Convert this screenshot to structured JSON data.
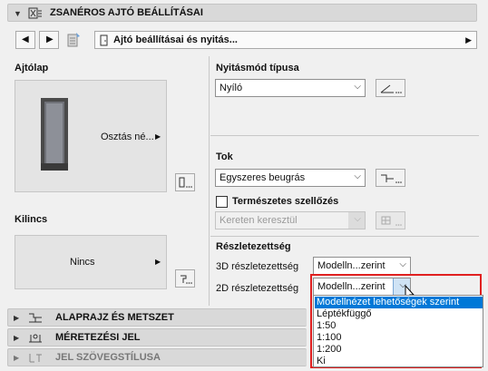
{
  "header": {
    "title": "ZSANÉROS AJTÓ BEÁLLÍTÁSAI"
  },
  "toolbar": {
    "path_label": "Ajtó beállításai és nyitás..."
  },
  "left": {
    "ajtolap_label": "Ajtólap",
    "ajtolap_button": "Osztás né...",
    "kilincs_label": "Kilincs",
    "kilincs_button": "Nincs"
  },
  "right": {
    "nyitasmod_label": "Nyitásmód típusa",
    "nyitasmod_value": "Nyíló",
    "tok_label": "Tok",
    "tok_value": "Egyszeres beugrás",
    "szellozes_label": "Természetes szellőzés",
    "szellozes_value": "Kereten keresztül",
    "reszletezettseg_label": "Részletezettség",
    "d3_label": "3D részletezettség",
    "d3_value": "Modelln...zerint",
    "d2_label": "2D részletezettség",
    "d2_value": "Modelln...zerint"
  },
  "dropdown": {
    "options": [
      "Modellnézet lehetőségek szerint",
      "Léptékfüggő",
      "1:50",
      "1:100",
      "1:200",
      "Ki"
    ],
    "selected_index": 0,
    "highlight_color": "#0078d7",
    "border_color": "#e02020"
  },
  "sections": [
    {
      "label": "ALAPRAJZ ÉS METSZET"
    },
    {
      "label": "MÉRETEZÉSI JEL"
    },
    {
      "label": "JEL SZÖVEGSTÍLUSA"
    }
  ]
}
